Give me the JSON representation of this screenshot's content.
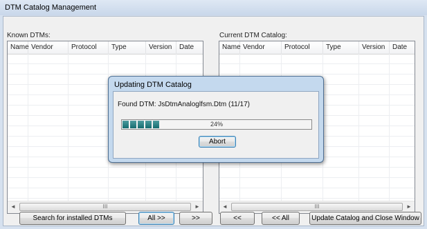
{
  "window": {
    "title": "DTM Catalog Management"
  },
  "known_dtms": {
    "label": "Known DTMs:",
    "columns": [
      "Name",
      "Vendor",
      "Protocol",
      "Type",
      "Version",
      "Date"
    ]
  },
  "current_catalog": {
    "label": "Current DTM Catalog:",
    "columns": [
      "Name",
      "Vendor",
      "Protocol",
      "Type",
      "Version",
      "Date"
    ]
  },
  "scroll": {
    "left_arrow": "◄",
    "right_arrow": "►",
    "grip": "III"
  },
  "buttons": {
    "search": "Search for installed DTMs",
    "all_right": "All  >>",
    "right": ">>",
    "left": "<<",
    "all_left": "<< All",
    "update_close": "Update Catalog and Close Window"
  },
  "dialog": {
    "title": "Updating DTM Catalog",
    "message": "Found DTM: JsDtmAnaloglfsm.Dtm (11/17)",
    "progress_percent": 24,
    "progress_text": "24%",
    "abort_label": "Abort"
  },
  "colors": {
    "progress_fill": "#1a7074",
    "titlebar": "#d3dfee",
    "dialog_frame": "#c4d9ee"
  }
}
